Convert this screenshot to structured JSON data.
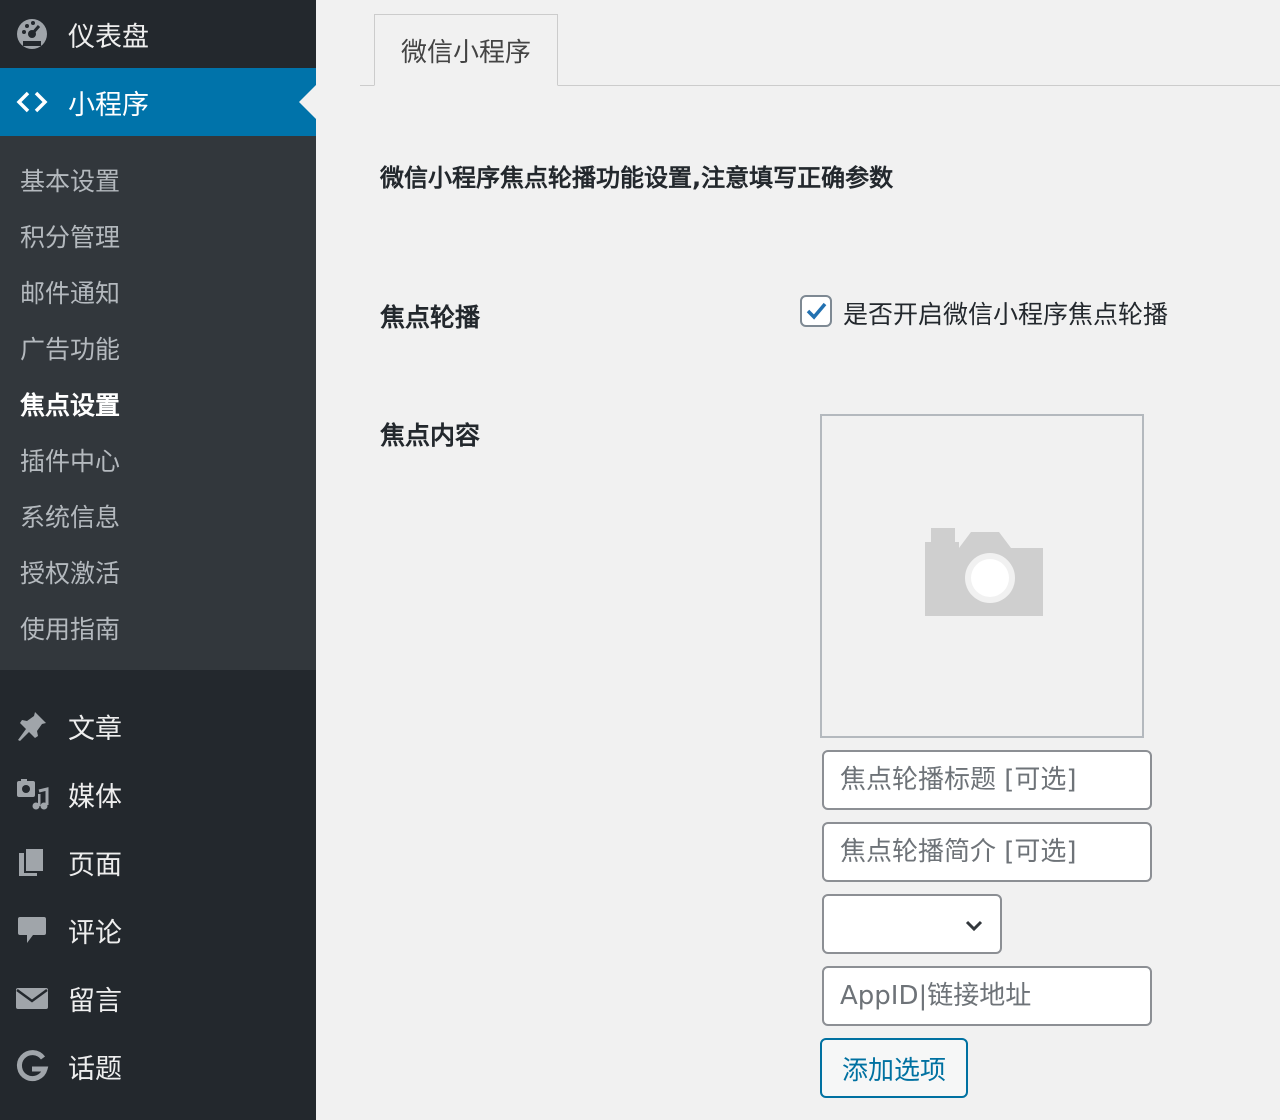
{
  "sidebar": {
    "top_items": [
      {
        "label": "仪表盘",
        "icon": "dashboard-icon"
      },
      {
        "label": "小程序",
        "icon": "code-icon"
      }
    ],
    "submenu": [
      "基本设置",
      "积分管理",
      "邮件通知",
      "广告功能",
      "焦点设置",
      "插件中心",
      "系统信息",
      "授权激活",
      "使用指南"
    ],
    "active_submenu": "焦点设置",
    "bottom_items": [
      {
        "label": "文章",
        "icon": "pushpin-icon"
      },
      {
        "label": "媒体",
        "icon": "media-icon"
      },
      {
        "label": "页面",
        "icon": "page-icon"
      },
      {
        "label": "评论",
        "icon": "comment-icon"
      },
      {
        "label": "留言",
        "icon": "envelope-icon"
      },
      {
        "label": "话题",
        "icon": "g-icon"
      }
    ]
  },
  "main": {
    "tab_label": "微信小程序",
    "intro": "微信小程序焦点轮播功能设置,注意填写正确参数",
    "carousel": {
      "label": "焦点轮播",
      "checkbox_label": "是否开启微信小程序焦点轮播",
      "checked": true
    },
    "content": {
      "label": "焦点内容",
      "image_placeholder_icon": "camera-icon",
      "title_placeholder": "焦点轮播标题 [可选]",
      "summary_placeholder": "焦点轮播简介 [可选]",
      "select_value": "",
      "link_placeholder": "AppID|链接地址",
      "add_button": "添加选项"
    }
  },
  "colors": {
    "sidebar_bg": "#23282d",
    "submenu_bg": "#32373c",
    "accent": "#0073aa",
    "page_bg": "#f1f1f1"
  }
}
